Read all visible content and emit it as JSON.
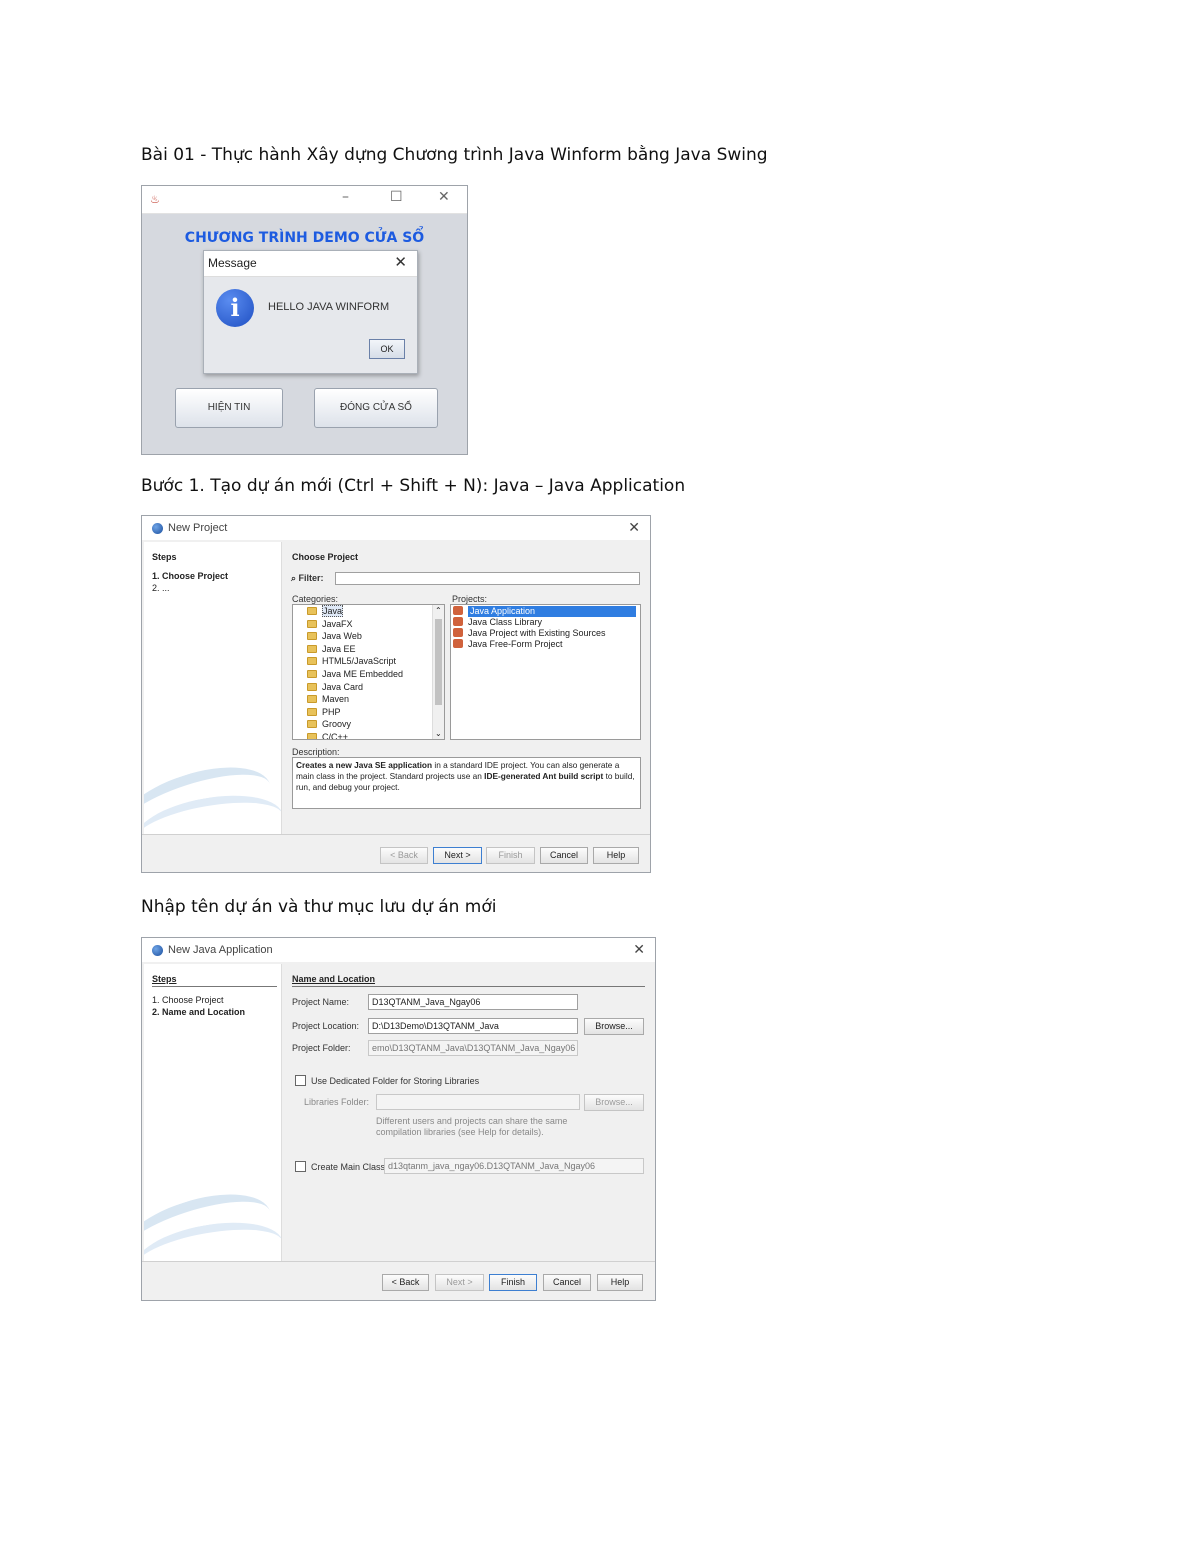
{
  "doc": {
    "heading1": "Bài 01 - Thực hành Xây dựng Chương trình Java Winform bằng Java Swing",
    "heading2": "Bước 1. Tạo dự án mới (Ctrl + Shift + N): Java – Java Application",
    "heading3": "Nhập tên dự án và thư mục lưu dự án mới"
  },
  "demo_window": {
    "controls": {
      "minimize": "–",
      "maximize": "☐",
      "close": "✕"
    },
    "title": "CHƯƠNG TRÌNH DEMO CỬA SỔ",
    "message_dialog": {
      "title": "Message",
      "close": "✕",
      "icon": "info-icon",
      "icon_glyph": "i",
      "text": "HELLO JAVA WINFORM",
      "ok_label": "OK"
    },
    "buttons": {
      "show": "HIỆN TIN",
      "close": "ĐÓNG CỬA SỔ"
    }
  },
  "new_project_wizard": {
    "title": "New Project",
    "close": "✕",
    "steps_heading": "Steps",
    "steps": [
      "1.   Choose Project",
      "2.   ..."
    ],
    "section_title": "Choose Project",
    "filter_label": "Filter:",
    "filter_value": "",
    "categories_label": "Categories:",
    "projects_label": "Projects:",
    "categories": [
      "Java",
      "JavaFX",
      "Java Web",
      "Java EE",
      "HTML5/JavaScript",
      "Java ME Embedded",
      "Java Card",
      "Maven",
      "PHP",
      "Groovy",
      "C/C++"
    ],
    "selected_category": 0,
    "projects": [
      "Java Application",
      "Java Class Library",
      "Java Project with Existing Sources",
      "Java Free-Form Project"
    ],
    "selected_project": 0,
    "description_label": "Description:",
    "description": {
      "part1": "Creates a new Java SE application",
      "part2": " in a standard IDE project. You can also generate a main class in the project. Standard projects use an ",
      "part3": "IDE-generated Ant build script",
      "part4": " to build, run, and debug your project."
    },
    "buttons": {
      "back": "< Back",
      "next": "Next >",
      "finish": "Finish",
      "cancel": "Cancel",
      "help": "Help"
    }
  },
  "new_java_app_wizard": {
    "title": "New Java Application",
    "close": "✕",
    "steps_heading": "Steps",
    "steps": [
      "1.   Choose Project",
      "2.   Name and Location"
    ],
    "section_title": "Name and Location",
    "project_name_label": "Project Name:",
    "project_name_value": "D13QTANM_Java_Ngay06",
    "project_location_label": "Project Location:",
    "project_location_value": "D:\\D13Demo\\D13QTANM_Java",
    "browse_label": "Browse...",
    "project_folder_label": "Project Folder:",
    "project_folder_value": "emo\\D13QTANM_Java\\D13QTANM_Java_Ngay06",
    "dedicated_folder_label": "Use Dedicated Folder for Storing Libraries",
    "dedicated_folder_checked": false,
    "libraries_folder_label": "Libraries Folder:",
    "libraries_folder_value": "",
    "browse2_label": "Browse...",
    "libraries_hint": "Different users and projects can share the same compilation libraries (see Help for details).",
    "create_main_label": "Create Main Class",
    "create_main_checked": false,
    "main_class_value": "d13qtanm_java_ngay06.D13QTANM_Java_Ngay06",
    "buttons": {
      "back": "< Back",
      "next": "Next >",
      "finish": "Finish",
      "cancel": "Cancel",
      "help": "Help"
    }
  },
  "colors": {
    "demo_title": "#1d5be0",
    "selection": "#2f7de1"
  }
}
